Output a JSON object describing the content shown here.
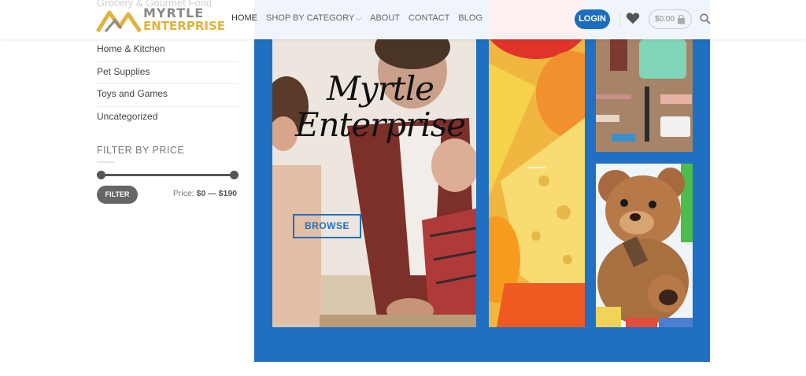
{
  "header": {
    "ghost_category": "Grocery & Gourmet Food",
    "logo": {
      "line1": "MYRTLE",
      "line2": "ENTERPRISE"
    },
    "nav": [
      "HOME",
      "SHOP BY CATEGORY",
      "ABOUT",
      "CONTACT",
      "BLOG"
    ],
    "login_label": "LOGIN",
    "cart_total": "$0.00"
  },
  "sidebar": {
    "categories": [
      "Home & Kitchen",
      "Pet Supplies",
      "Toys and Games",
      "Uncategorized"
    ],
    "filter_title": "FILTER BY PRICE",
    "price_range": {
      "min": 0,
      "max": 190,
      "handle_min_fraction": 0,
      "handle_max_fraction": 1
    },
    "filter_button": "FILTER",
    "price_prefix": "Price:",
    "price_text": "$0 — $190"
  },
  "banner": {
    "title_line1": "Myrtle",
    "title_line2": "Enterprise",
    "button": "BROWSE",
    "accent_color": "#1f6fc2"
  }
}
